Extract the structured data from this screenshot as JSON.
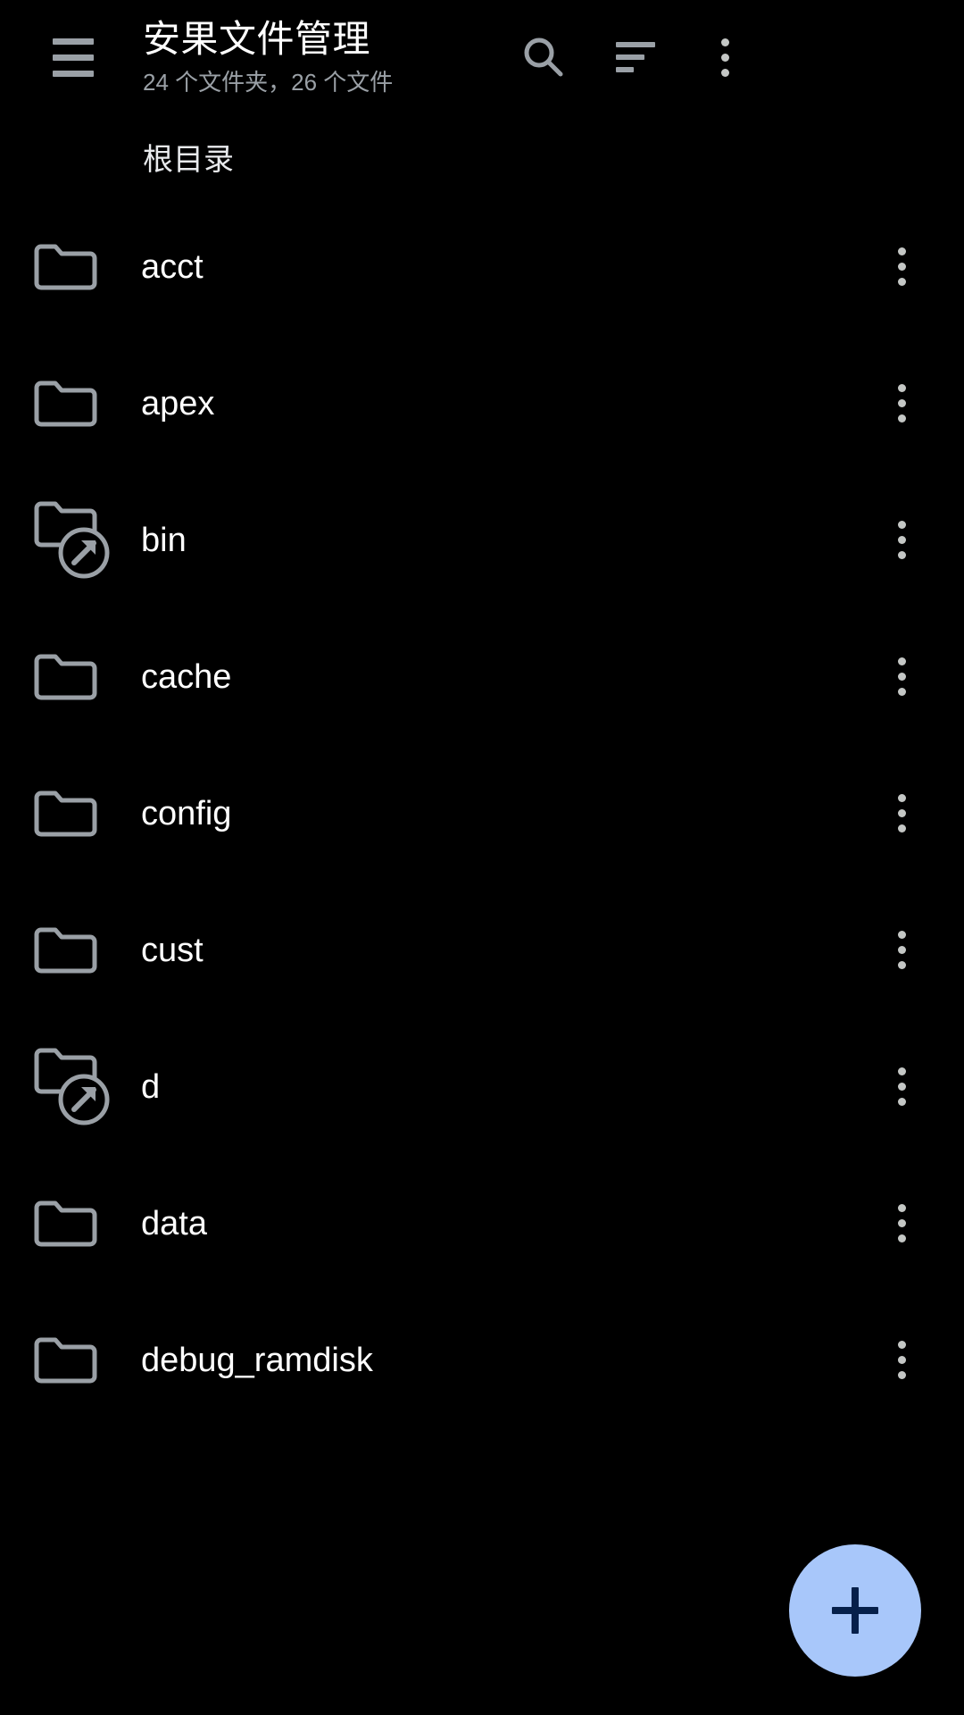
{
  "app": {
    "title": "安果文件管理",
    "subtitle": "24 个文件夹，26 个文件"
  },
  "toolbar": {
    "menu_icon": "hamburger-menu-icon",
    "search_icon": "search-icon",
    "sort_icon": "sort-icon",
    "more_icon": "overflow-menu-icon"
  },
  "breadcrumb": {
    "current": "根目录"
  },
  "fab": {
    "icon": "plus-icon",
    "color": "#A8C7FA",
    "icon_color": "#06204A"
  },
  "colors": {
    "background": "#000000",
    "primary_text": "#FFFFFF",
    "secondary_text": "#9AA0A6",
    "icon": "#9AA0A6",
    "kebab": "#C4C7C5",
    "accent": "#A8C7FA"
  },
  "file_list": {
    "row_menu_icon": "overflow-menu-icon",
    "items": [
      {
        "name": "acct",
        "icon": "folder-icon"
      },
      {
        "name": "apex",
        "icon": "folder-icon"
      },
      {
        "name": "bin",
        "icon": "folder-symlink-icon"
      },
      {
        "name": "cache",
        "icon": "folder-icon"
      },
      {
        "name": "config",
        "icon": "folder-icon"
      },
      {
        "name": "cust",
        "icon": "folder-icon"
      },
      {
        "name": "d",
        "icon": "folder-symlink-icon"
      },
      {
        "name": "data",
        "icon": "folder-icon"
      },
      {
        "name": "debug_ramdisk",
        "icon": "folder-icon"
      }
    ]
  }
}
